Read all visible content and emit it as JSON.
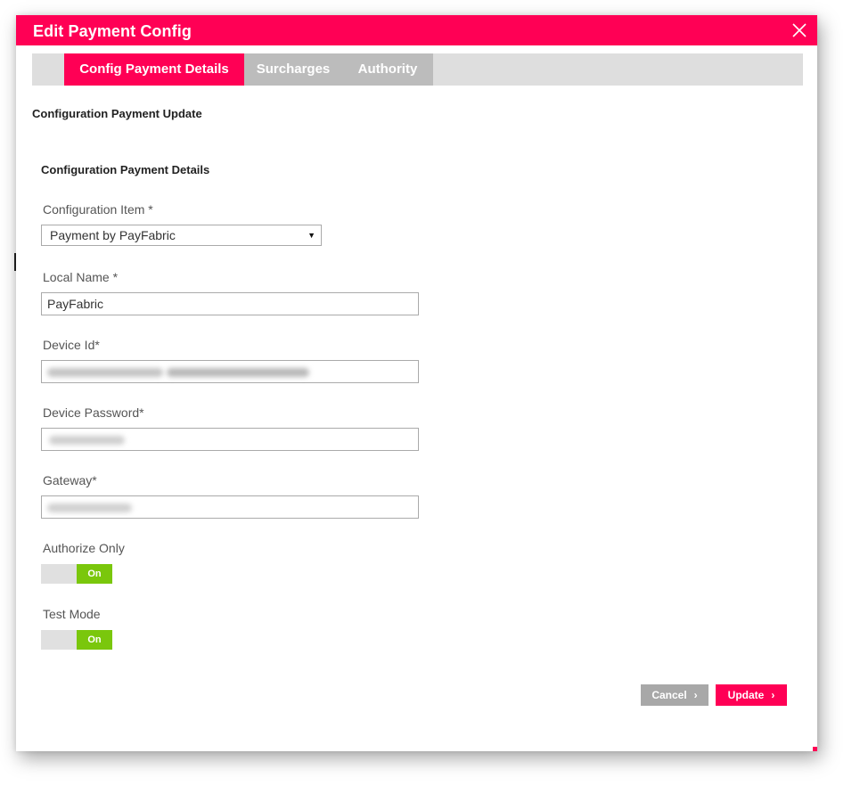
{
  "dialog": {
    "title": "Edit Payment Config",
    "close_icon": "close-icon"
  },
  "tabs": [
    {
      "label": "Config Payment Details",
      "active": true
    },
    {
      "label": "Surcharges",
      "active": false
    },
    {
      "label": "Authority",
      "active": false
    }
  ],
  "section_title": "Configuration Payment Update",
  "subsection_title": "Configuration Payment Details",
  "fields": {
    "configuration_item": {
      "label": "Configuration Item *",
      "value": "Payment by PayFabric"
    },
    "local_name": {
      "label": "Local Name *",
      "value": "PayFabric"
    },
    "device_id": {
      "label": "Device Id*"
    },
    "device_password": {
      "label": "Device Password*"
    },
    "gateway": {
      "label": "Gateway*"
    }
  },
  "toggles": {
    "authorize_only": {
      "label": "Authorize Only",
      "state_label": "On"
    },
    "test_mode": {
      "label": "Test Mode",
      "state_label": "On"
    }
  },
  "buttons": {
    "cancel": "Cancel",
    "update": "Update"
  },
  "colors": {
    "brand": "#ff0055",
    "toggle_on": "#7ac70c",
    "tabbar": "#dedede",
    "cancel": "#a8a8a8"
  }
}
